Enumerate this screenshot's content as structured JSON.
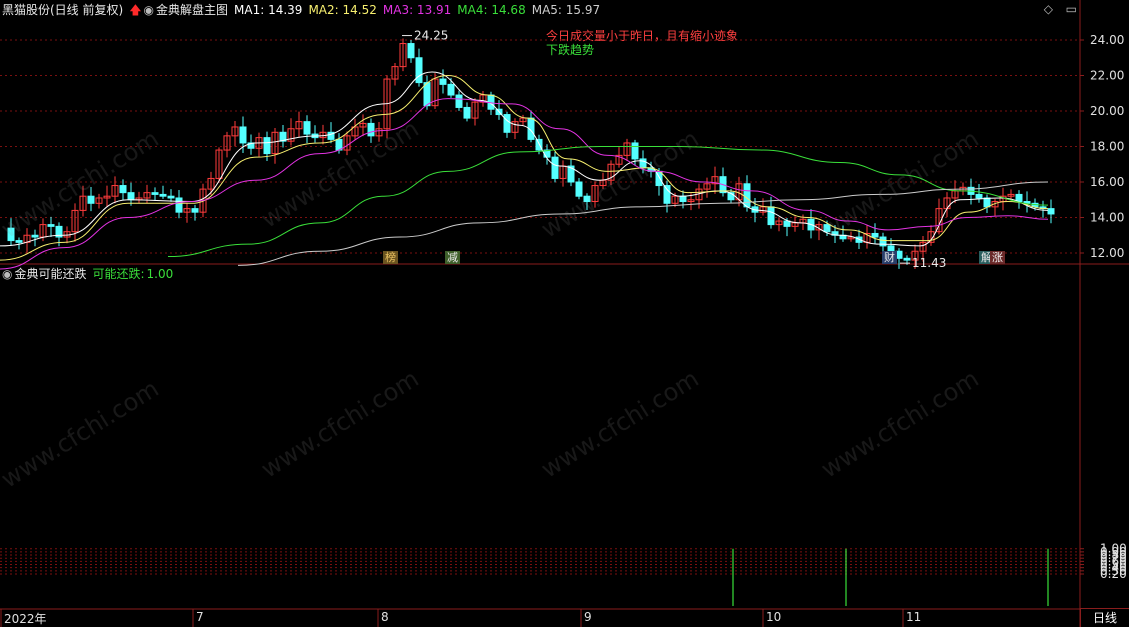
{
  "header": {
    "stock_name": "黑猫股份(日线 前复权)",
    "indicator_name": "金典解盘主图",
    "ma": [
      {
        "label": "MA1:",
        "value": "14.39",
        "color": "#ffffff"
      },
      {
        "label": "MA2:",
        "value": "14.52",
        "color": "#f7ef6f"
      },
      {
        "label": "MA3:",
        "value": "13.91",
        "color": "#e233e2"
      },
      {
        "label": "MA4:",
        "value": "14.68",
        "color": "#3adf3a"
      },
      {
        "label": "MA5:",
        "value": "15.97",
        "color": "#cccccc"
      }
    ]
  },
  "sub_header": {
    "indicator_name": "金典可能还跌",
    "series_label": "可能还跌:",
    "series_value": "1.00"
  },
  "annotations": {
    "line1": "今日成交量小于昨日，且有缩小迹象",
    "line2": "下跌趋势",
    "peak_label": "24.25",
    "trough_label": "11.43"
  },
  "badges": [
    {
      "text": "榜",
      "bg": "#6b5420",
      "fg": "#e8c060"
    },
    {
      "text": "减",
      "bg": "#3f5f2a",
      "fg": "#e8e8e8"
    },
    {
      "text": "财",
      "bg": "#2a3f6b",
      "fg": "#e8e8e8"
    },
    {
      "text": "解",
      "bg": "#2a5f5f",
      "fg": "#e8e8e8"
    },
    {
      "text": "涨",
      "bg": "#6b2a2a",
      "fg": "#f0f0f0"
    }
  ],
  "x_axis": {
    "labels": [
      "2022年",
      "7",
      "8",
      "9",
      "10",
      "11"
    ],
    "period_tab": "日线"
  },
  "watermark": "www.cfchi.com",
  "colors": {
    "up": "#ff3c3c",
    "down": "#54ffff",
    "grid": "#7a1010",
    "axis_text": "#e0e0e0"
  },
  "chart_data": [
    {
      "type": "candlestick",
      "title": "金典解盘主图",
      "ylim": [
        11.0,
        24.9
      ],
      "y_ticks": [
        12.0,
        14.0,
        16.0,
        18.0,
        20.0,
        22.0,
        24.0
      ],
      "high_label": 24.25,
      "low_label": 11.43,
      "path": [
        [
          0,
          13.4
        ],
        [
          8,
          12.7
        ],
        [
          16,
          12.6
        ],
        [
          24,
          13.0
        ],
        [
          32,
          12.9
        ],
        [
          40,
          13.6
        ],
        [
          48,
          13.5
        ],
        [
          56,
          12.9
        ],
        [
          64,
          13.2
        ],
        [
          72,
          14.4
        ],
        [
          80,
          15.2
        ],
        [
          88,
          14.8
        ],
        [
          96,
          15.1
        ],
        [
          104,
          15.2
        ],
        [
          112,
          15.8
        ],
        [
          120,
          15.4
        ],
        [
          128,
          15.0
        ],
        [
          136,
          15.1
        ],
        [
          144,
          15.4
        ],
        [
          152,
          15.3
        ],
        [
          160,
          15.2
        ],
        [
          168,
          15.1
        ],
        [
          176,
          14.3
        ],
        [
          184,
          14.5
        ],
        [
          192,
          14.3
        ],
        [
          200,
          15.6
        ],
        [
          208,
          16.2
        ],
        [
          216,
          17.8
        ],
        [
          224,
          18.6
        ],
        [
          232,
          19.1
        ],
        [
          240,
          18.2
        ],
        [
          248,
          17.9
        ],
        [
          256,
          18.5
        ],
        [
          264,
          17.6
        ],
        [
          272,
          18.8
        ],
        [
          280,
          18.3
        ],
        [
          288,
          19.0
        ],
        [
          296,
          19.4
        ],
        [
          304,
          18.7
        ],
        [
          312,
          18.5
        ],
        [
          320,
          18.8
        ],
        [
          328,
          18.4
        ],
        [
          336,
          17.8
        ],
        [
          344,
          18.6
        ],
        [
          352,
          19.1
        ],
        [
          360,
          19.3
        ],
        [
          368,
          18.6
        ],
        [
          376,
          19.0
        ],
        [
          384,
          21.8
        ],
        [
          392,
          22.5
        ],
        [
          400,
          23.8
        ],
        [
          408,
          23.0
        ],
        [
          416,
          21.6
        ],
        [
          424,
          20.3
        ],
        [
          432,
          21.8
        ],
        [
          440,
          21.5
        ],
        [
          448,
          20.9
        ],
        [
          456,
          20.2
        ],
        [
          464,
          19.6
        ],
        [
          472,
          20.5
        ],
        [
          480,
          20.9
        ],
        [
          488,
          20.1
        ],
        [
          496,
          19.8
        ],
        [
          504,
          18.8
        ],
        [
          512,
          19.4
        ],
        [
          520,
          19.6
        ],
        [
          528,
          18.4
        ],
        [
          536,
          17.8
        ],
        [
          544,
          17.4
        ],
        [
          552,
          16.2
        ],
        [
          560,
          16.9
        ],
        [
          568,
          16.0
        ],
        [
          576,
          15.2
        ],
        [
          584,
          14.9
        ],
        [
          592,
          15.8
        ],
        [
          600,
          16.1
        ],
        [
          608,
          17.0
        ],
        [
          616,
          17.5
        ],
        [
          624,
          18.2
        ],
        [
          632,
          17.3
        ],
        [
          640,
          16.8
        ],
        [
          648,
          16.6
        ],
        [
          656,
          15.8
        ],
        [
          664,
          14.8
        ],
        [
          672,
          15.2
        ],
        [
          680,
          14.9
        ],
        [
          688,
          15.0
        ],
        [
          696,
          15.6
        ],
        [
          704,
          15.9
        ],
        [
          712,
          16.3
        ],
        [
          720,
          15.4
        ],
        [
          728,
          15.0
        ],
        [
          736,
          15.9
        ],
        [
          744,
          14.6
        ],
        [
          752,
          14.3
        ],
        [
          760,
          14.6
        ],
        [
          768,
          13.6
        ],
        [
          776,
          13.8
        ],
        [
          784,
          13.5
        ],
        [
          792,
          13.7
        ],
        [
          800,
          13.9
        ],
        [
          808,
          13.3
        ],
        [
          816,
          13.6
        ],
        [
          824,
          13.2
        ],
        [
          832,
          13.0
        ],
        [
          840,
          12.8
        ],
        [
          848,
          12.9
        ],
        [
          856,
          12.6
        ],
        [
          864,
          13.1
        ],
        [
          872,
          12.9
        ],
        [
          880,
          12.4
        ],
        [
          888,
          12.1
        ],
        [
          896,
          11.7
        ],
        [
          904,
          11.6
        ],
        [
          912,
          12.1
        ],
        [
          920,
          12.6
        ],
        [
          928,
          13.2
        ],
        [
          936,
          14.5
        ],
        [
          944,
          15.1
        ],
        [
          952,
          15.5
        ],
        [
          960,
          15.7
        ],
        [
          968,
          15.3
        ],
        [
          976,
          15.1
        ],
        [
          984,
          14.6
        ],
        [
          992,
          14.9
        ],
        [
          1000,
          15.2
        ],
        [
          1008,
          15.3
        ],
        [
          1016,
          14.9
        ],
        [
          1024,
          14.8
        ],
        [
          1032,
          14.6
        ],
        [
          1040,
          14.5
        ],
        [
          1048,
          14.2
        ]
      ],
      "series": [
        {
          "name": "MA1",
          "color": "#ffffff",
          "x": [
            0,
            64,
            128,
            192,
            256,
            320,
            384,
            432,
            480,
            520,
            560,
            600,
            640,
            680,
            720,
            760,
            800,
            840,
            880,
            920,
            960,
            1000,
            1048
          ],
          "values": [
            12.4,
            13.0,
            15.0,
            14.9,
            18.2,
            18.6,
            20.4,
            22.2,
            20.6,
            19.2,
            16.9,
            16.1,
            17.2,
            15.2,
            15.5,
            14.4,
            13.7,
            13.0,
            12.5,
            12.4,
            15.0,
            15.1,
            14.4
          ]
        },
        {
          "name": "MA2",
          "color": "#f7ef6f",
          "x": [
            0,
            64,
            128,
            192,
            256,
            320,
            384,
            448,
            488,
            528,
            568,
            608,
            648,
            688,
            728,
            768,
            808,
            848,
            888,
            928,
            968,
            1008,
            1048
          ],
          "values": [
            11.6,
            12.6,
            14.8,
            14.8,
            17.4,
            18.2,
            19.8,
            22.0,
            20.9,
            19.6,
            17.3,
            16.6,
            16.8,
            15.4,
            15.5,
            14.6,
            14.0,
            13.3,
            12.7,
            12.7,
            14.3,
            14.9,
            14.5
          ]
        },
        {
          "name": "MA3",
          "color": "#e233e2",
          "x": [
            0,
            64,
            128,
            192,
            256,
            320,
            384,
            448,
            512,
            560,
            608,
            656,
            704,
            752,
            808,
            848,
            888,
            928,
            968,
            1008,
            1048
          ],
          "values": [
            11.1,
            12.3,
            14.0,
            14.9,
            16.1,
            17.6,
            18.9,
            20.7,
            20.4,
            19.0,
            17.5,
            16.6,
            16.0,
            15.5,
            14.4,
            13.8,
            13.3,
            13.5,
            14.0,
            14.1,
            13.9
          ]
        },
        {
          "name": "MA4",
          "color": "#3adf3a",
          "x": [
            168,
            248,
            320,
            384,
            448,
            520,
            600,
            680,
            760,
            840,
            900,
            960,
            1048
          ],
          "values": [
            11.8,
            12.5,
            13.7,
            15.2,
            16.6,
            17.7,
            18.0,
            18.0,
            17.8,
            17.1,
            16.4,
            15.5,
            14.7
          ]
        },
        {
          "name": "MA5",
          "color": "#cccccc",
          "x": [
            238,
            320,
            400,
            480,
            560,
            640,
            720,
            800,
            880,
            960,
            1048
          ],
          "values": [
            11.3,
            12.1,
            12.9,
            13.7,
            14.2,
            14.6,
            14.8,
            15.0,
            15.3,
            15.6,
            16.0
          ]
        }
      ]
    },
    {
      "type": "bar",
      "title": "金典可能还跌",
      "ylim": [
        0,
        1.05
      ],
      "y_ticks": [
        0.2,
        0.3,
        0.4,
        0.5,
        0.6,
        0.7,
        0.8,
        0.9,
        1.0
      ],
      "series": [
        {
          "name": "可能还跌",
          "color": "#3adf3a",
          "x": [
            733,
            846,
            1048
          ],
          "values": [
            1.0,
            1.0,
            1.0
          ]
        }
      ]
    }
  ]
}
